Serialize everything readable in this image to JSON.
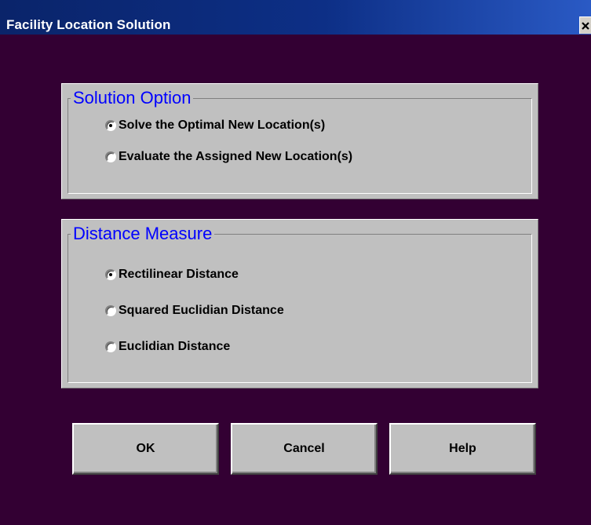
{
  "window": {
    "title": "Facility Location Solution",
    "close_glyph": "×",
    "colors": {
      "background": "#330033",
      "panel": "#c0c0c0",
      "legend_text": "#0000ff",
      "titlebar": "#0a246a"
    }
  },
  "solution_option": {
    "legend": "Solution Option",
    "options": [
      {
        "label": "Solve the Optimal New Location(s)",
        "selected": true
      },
      {
        "label": "Evaluate the Assigned New Location(s)",
        "selected": false
      }
    ]
  },
  "distance_measure": {
    "legend": "Distance Measure",
    "options": [
      {
        "label": "Rectilinear Distance",
        "selected": true
      },
      {
        "label": "Squared Euclidian Distance",
        "selected": false
      },
      {
        "label": "Euclidian Distance",
        "selected": false
      }
    ]
  },
  "buttons": {
    "ok": "OK",
    "cancel": "Cancel",
    "help": "Help"
  }
}
